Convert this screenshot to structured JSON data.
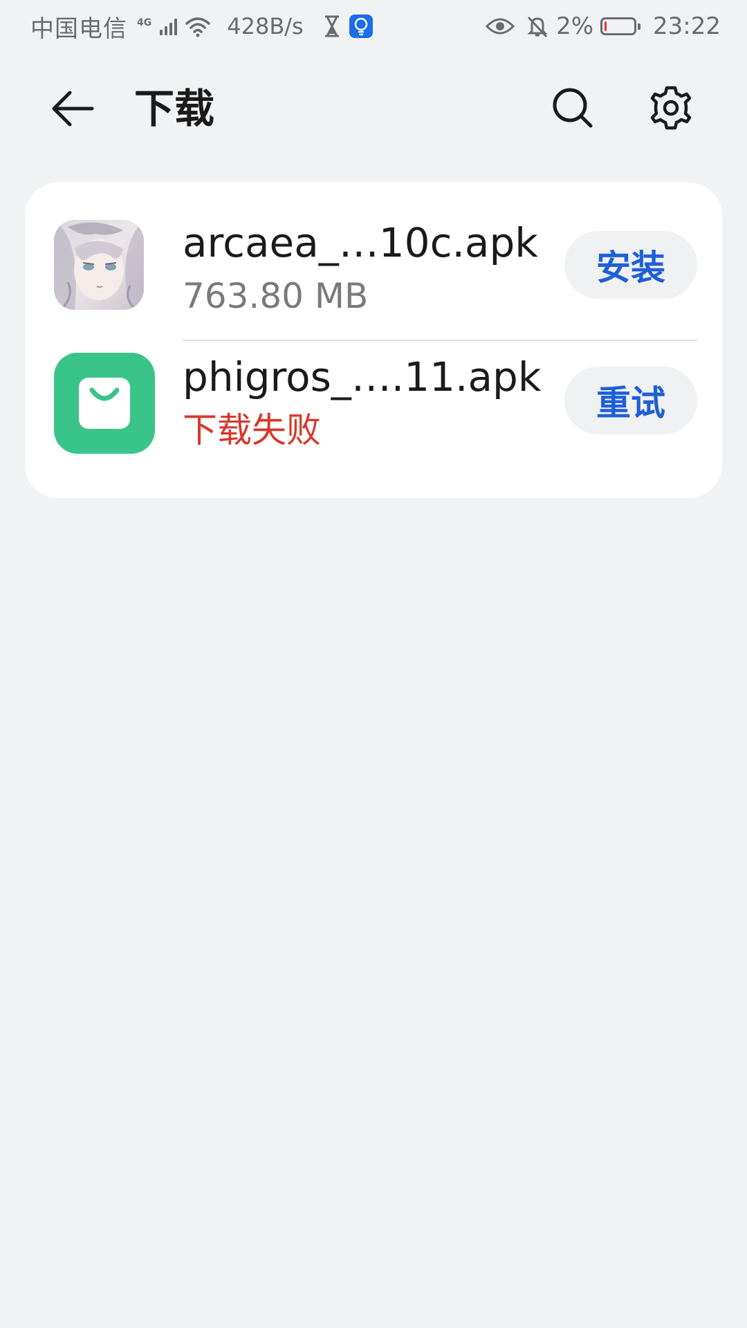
{
  "status_bar": {
    "carrier": "中国电信",
    "network": "4G",
    "speed": "428B/s",
    "battery": "2%",
    "battery_level": 0.02,
    "time": "23:22",
    "icons": [
      "signal-icon",
      "wifi-icon",
      "hourglass-icon",
      "assistant-icon",
      "eye-icon",
      "bell-muted-icon",
      "battery-icon"
    ]
  },
  "app_bar": {
    "title": "下载",
    "back_icon": "arrow-left-icon",
    "search_icon": "search-icon",
    "settings_icon": "gear-icon"
  },
  "downloads": [
    {
      "file_name": "arcaea_…10c.apk",
      "subtitle": "763.80 MB",
      "action_label": "安装",
      "icon": "arcaea-app-icon"
    },
    {
      "file_name": "phigros_….11.apk",
      "subtitle": "下载失败",
      "action_label": "重试",
      "icon": "shopping-bag-icon"
    }
  ],
  "colors": {
    "background": "#f1f2f4",
    "card": "#ffffff",
    "accent": "#1e5fd8",
    "error": "#d9372b",
    "store_icon": "#3ac48a"
  }
}
